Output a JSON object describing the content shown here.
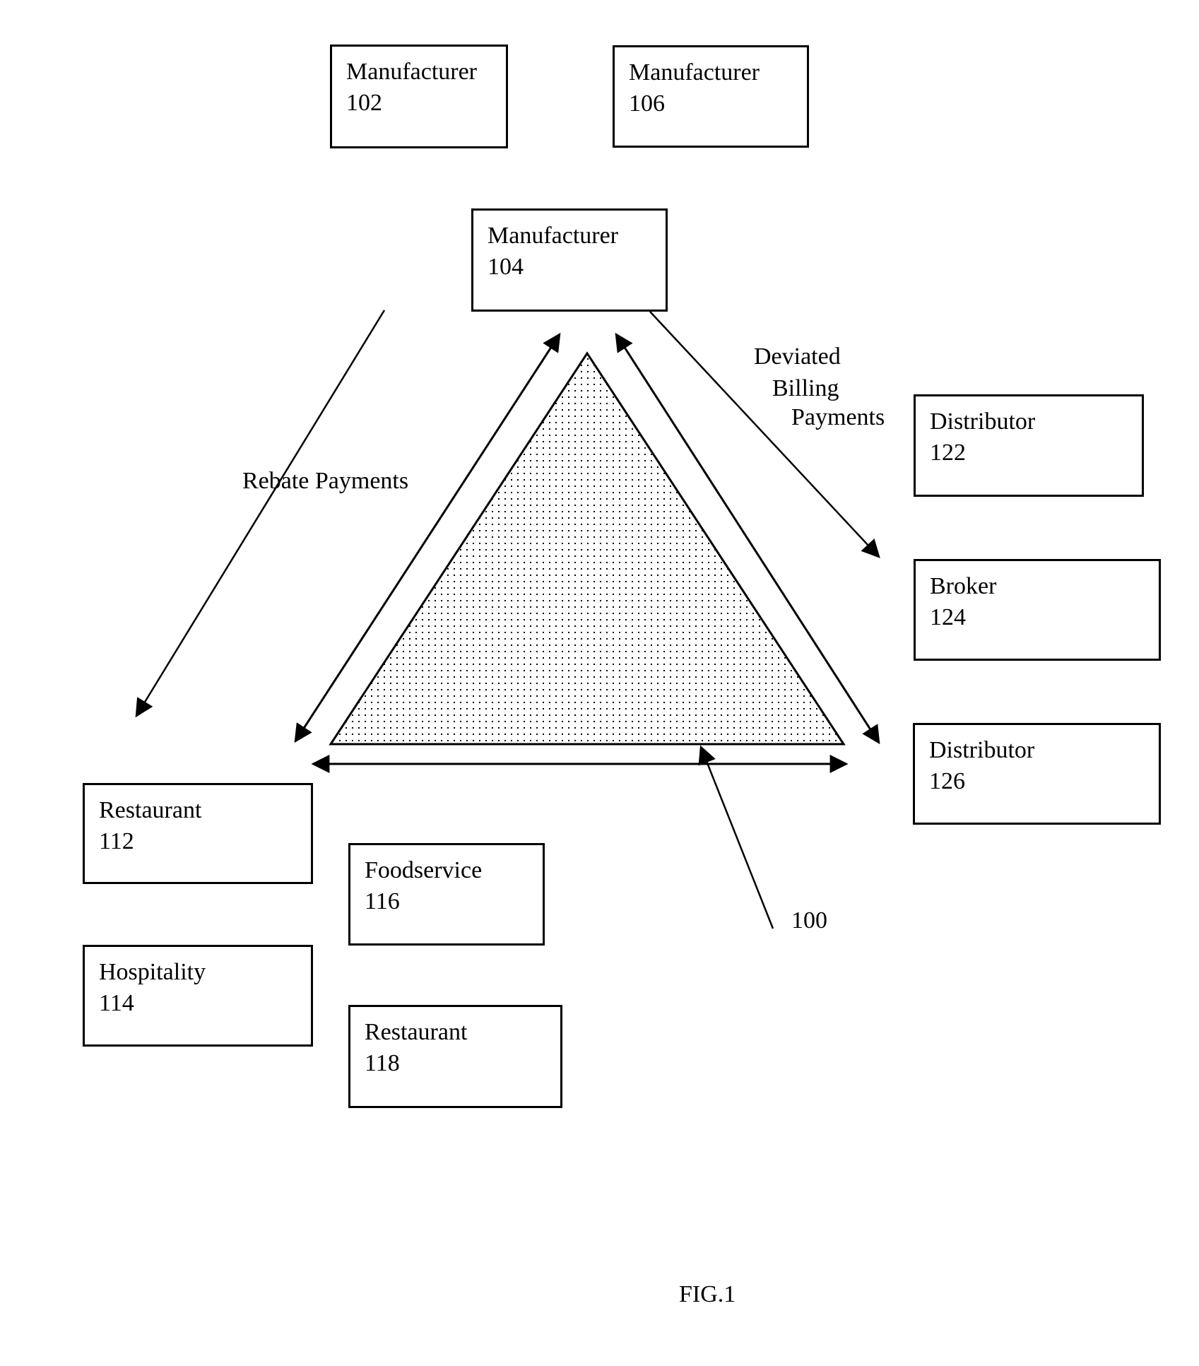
{
  "figure": {
    "caption": "FIG.1",
    "reference_numeral": "100"
  },
  "boxes": {
    "m102": {
      "label": "Manufacturer",
      "number": "102"
    },
    "m106": {
      "label": "Manufacturer",
      "number": "106"
    },
    "m104": {
      "label": "Manufacturer",
      "number": "104"
    },
    "d122": {
      "label": "Distributor",
      "number": "122"
    },
    "b124": {
      "label": "Broker",
      "number": "124"
    },
    "d126": {
      "label": "Distributor",
      "number": "126"
    },
    "r112": {
      "label": "Restaurant",
      "number": "112"
    },
    "h114": {
      "label": "Hospitality",
      "number": "114"
    },
    "f116": {
      "label": "Foodservice",
      "number": "116"
    },
    "r118": {
      "label": "Restaurant",
      "number": "118"
    }
  },
  "annotations": {
    "rebate": "Rebate Payments",
    "deviated_line1": "Deviated",
    "deviated_line2": "Billing",
    "deviated_line3": "Payments"
  },
  "colors": {
    "ink": "#000000",
    "background": "#ffffff"
  }
}
